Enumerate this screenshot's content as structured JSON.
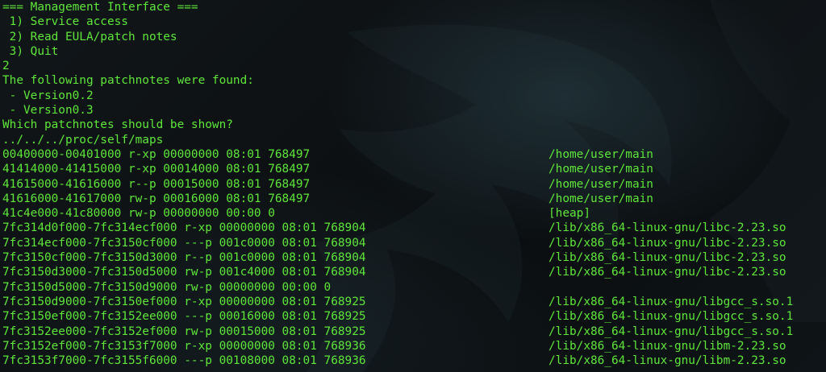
{
  "terminal": {
    "text_color": "#5ee63a",
    "background": "#0c0f12",
    "session": [
      "=== Management Interface ===",
      " 1) Service access",
      " 2) Read EULA/patch notes",
      " 3) Quit",
      "2",
      "The following patchnotes were found:",
      " - Version0.2",
      " - Version0.3",
      "Which patchnotes should be shown?",
      "../../../proc/self/maps"
    ],
    "maps": [
      {
        "range": "00400000-00401000 r-xp 00000000 08:01 768497",
        "path": "/home/user/main"
      },
      {
        "range": "41414000-41415000 r-xp 00014000 08:01 768497",
        "path": "/home/user/main"
      },
      {
        "range": "41615000-41616000 r--p 00015000 08:01 768497",
        "path": "/home/user/main"
      },
      {
        "range": "41616000-41617000 rw-p 00016000 08:01 768497",
        "path": "/home/user/main"
      },
      {
        "range": "41c4e000-41c80000 rw-p 00000000 00:00 0",
        "path": "[heap]"
      },
      {
        "range": "7fc314d0f000-7fc314ecf000 r-xp 00000000 08:01 768904",
        "path": "/lib/x86_64-linux-gnu/libc-2.23.so"
      },
      {
        "range": "7fc314ecf000-7fc3150cf000 ---p 001c0000 08:01 768904",
        "path": "/lib/x86_64-linux-gnu/libc-2.23.so"
      },
      {
        "range": "7fc3150cf000-7fc3150d3000 r--p 001c0000 08:01 768904",
        "path": "/lib/x86_64-linux-gnu/libc-2.23.so"
      },
      {
        "range": "7fc3150d3000-7fc3150d5000 rw-p 001c4000 08:01 768904",
        "path": "/lib/x86_64-linux-gnu/libc-2.23.so"
      },
      {
        "range": "7fc3150d5000-7fc3150d9000 rw-p 00000000 00:00 0",
        "path": ""
      },
      {
        "range": "7fc3150d9000-7fc3150ef000 r-xp 00000000 08:01 768925",
        "path": "/lib/x86_64-linux-gnu/libgcc_s.so.1"
      },
      {
        "range": "7fc3150ef000-7fc3152ee000 ---p 00016000 08:01 768925",
        "path": "/lib/x86_64-linux-gnu/libgcc_s.so.1"
      },
      {
        "range": "7fc3152ee000-7fc3152ef000 rw-p 00015000 08:01 768925",
        "path": "/lib/x86_64-linux-gnu/libgcc_s.so.1"
      },
      {
        "range": "7fc3152ef000-7fc3153f7000 r-xp 00000000 08:01 768936",
        "path": "/lib/x86_64-linux-gnu/libm-2.23.so"
      },
      {
        "range": "7fc3153f7000-7fc3155f6000 ---p 00108000 08:01 768936",
        "path": "/lib/x86_64-linux-gnu/libm-2.23.so"
      }
    ]
  }
}
